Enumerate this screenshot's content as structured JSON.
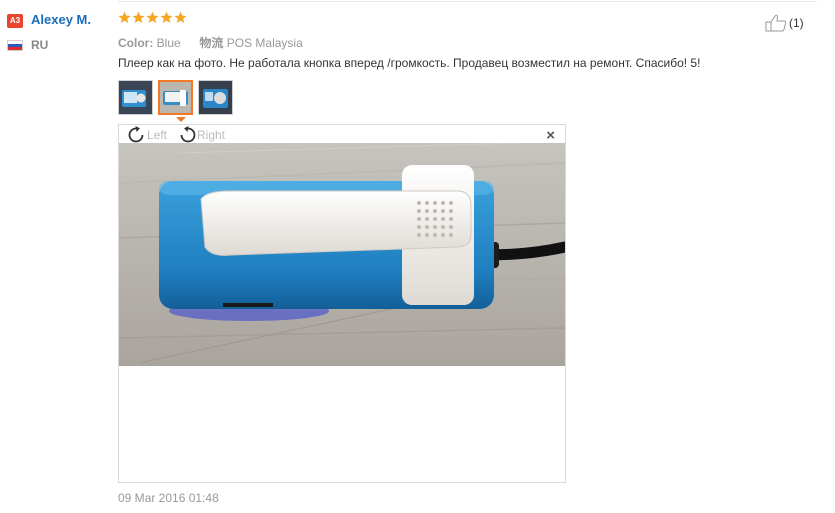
{
  "user": {
    "badge": "A3",
    "name": "Alexey M.",
    "country": "RU",
    "flag_colors": [
      "#ffffff",
      "#2a59c4",
      "#e02a2a"
    ]
  },
  "review": {
    "rating": 5,
    "star_color": "#f5a623",
    "color_label": "Color:",
    "color_value": "Blue",
    "shipping_label": "物流",
    "shipping_value": "POS Malaysia",
    "text": "Плеер как на фото. Не работала кнопка вперед /громкость. Продавец возместил на ремонт. Спасибо! 5!",
    "date": "09 Mar 2016 01:48"
  },
  "helpful": {
    "icon": "thumbs-up-icon",
    "count": "(1)"
  },
  "thumbnails": {
    "count": 3,
    "active_index": 1,
    "accent": "#f07a2a"
  },
  "viewer": {
    "rotate_left_label": "Left",
    "rotate_right_label": "Right",
    "close_glyph": "×"
  }
}
